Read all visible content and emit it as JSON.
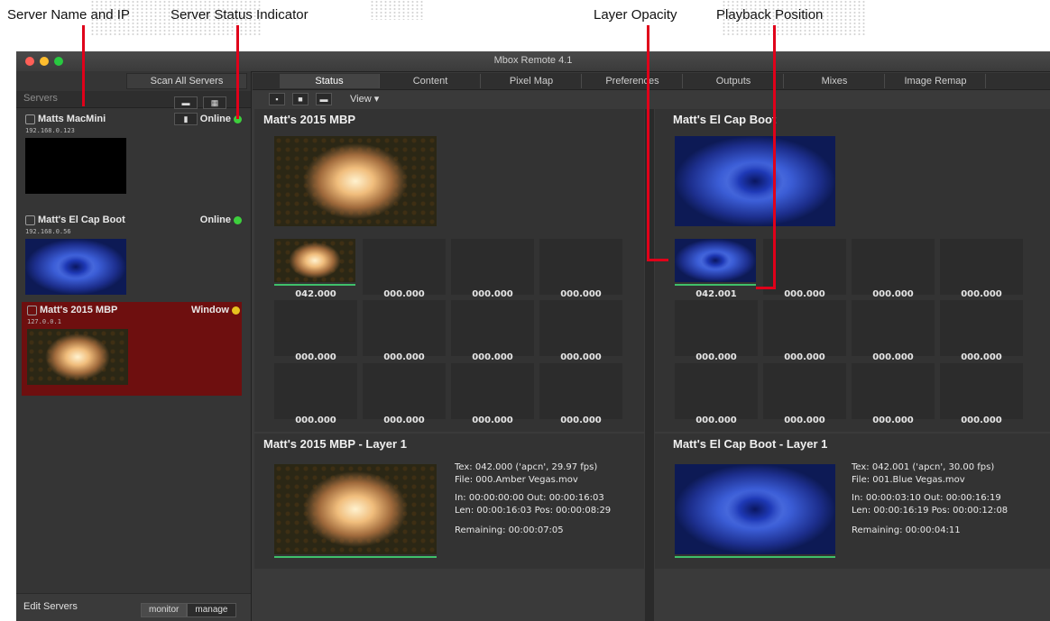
{
  "annotations": [
    {
      "label": "Server Name and IP"
    },
    {
      "label": "Server Status Indicator"
    },
    {
      "label": "Layer Opacity"
    },
    {
      "label": "Playback Position"
    }
  ],
  "window": {
    "title": "Mbox Remote 4.1"
  },
  "sidebar": {
    "scan_button": "Scan All Servers",
    "header": "Servers",
    "servers": [
      {
        "name": "Matts MacMini",
        "ip": "192.168.0.123",
        "status": "Online",
        "status_color": "#3dcf3d",
        "thumb": "black"
      },
      {
        "name": "Matt's El Cap Boot",
        "ip": "192.168.0.56",
        "status": "Online",
        "status_color": "#3dcf3d",
        "thumb": "blue"
      },
      {
        "name": "Matt's 2015 MBP",
        "ip": "127.0.0.1",
        "status": "Window",
        "status_color": "#e6c21f",
        "thumb": "amber"
      }
    ],
    "edit_servers": "Edit Servers",
    "mode_monitor": "monitor",
    "mode_manage": "manage"
  },
  "tabs": [
    "Status",
    "Content",
    "Pixel Map",
    "Preferences",
    "Outputs",
    "Mixes",
    "Image Remap"
  ],
  "toolbar": {
    "view_label": "View"
  },
  "panels": {
    "left_status": {
      "title": "Matt's 2015 MBP",
      "values": [
        "042.000",
        "000.000",
        "000.000",
        "000.000",
        "000.000",
        "000.000",
        "000.000",
        "000.000",
        "000.000",
        "000.000",
        "000.000",
        "000.000"
      ]
    },
    "right_status": {
      "title": "Matt's El Cap Boot",
      "values": [
        "042.001",
        "000.000",
        "000.000",
        "000.000",
        "000.000",
        "000.000",
        "000.000",
        "000.000",
        "000.000",
        "000.000",
        "000.000",
        "000.000"
      ]
    },
    "left_layer": {
      "title": "Matt's 2015 MBP - Layer 1",
      "tex": "Tex: 042.000 ('apcn', 29.97 fps)",
      "file": "File: 000.Amber Vegas.mov",
      "in_out": "In:   00:00:00:00   Out: 00:00:16:03",
      "len_pos": "Len: 00:00:16:03   Pos: 00:00:08:29",
      "remaining": "Remaining: 00:00:07:05"
    },
    "right_layer": {
      "title": "Matt's El Cap Boot - Layer 1",
      "tex": "Tex: 042.001 ('apcn', 30.00 fps)",
      "file": "File: 001.Blue Vegas.mov",
      "in_out": "In:   00:00:03:10   Out: 00:00:16:19",
      "len_pos": "Len: 00:00:16:19   Pos: 00:00:12:08",
      "remaining": "Remaining: 00:00:04:11"
    }
  }
}
